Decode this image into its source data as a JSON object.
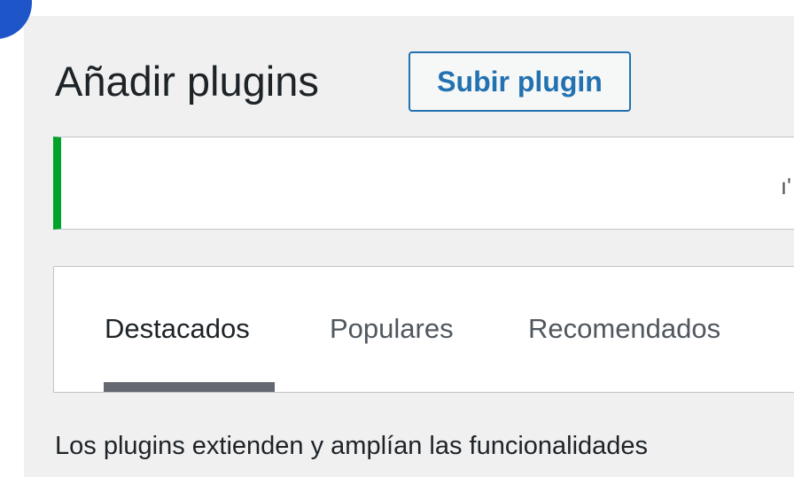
{
  "header": {
    "title": "Añadir plugins",
    "upload_label": "Subir plugin"
  },
  "notice": {
    "partial_text": "ı'"
  },
  "tabs": [
    {
      "label": "Destacados",
      "active": true
    },
    {
      "label": "Populares",
      "active": false
    },
    {
      "label": "Recomendados",
      "active": false
    }
  ],
  "main": {
    "description": "Los plugins extienden y amplían las funcionalidades"
  },
  "colors": {
    "accent": "#2271b1",
    "notice_border": "#00a32a",
    "corner_badge": "#1e56c9",
    "active_tab_indicator": "#646970"
  }
}
